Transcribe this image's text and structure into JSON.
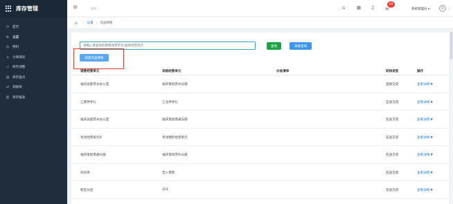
{
  "app": {
    "title": "库存管理"
  },
  "sidebar": {
    "items": [
      {
        "label": "首页",
        "icon": "home-icon",
        "glyph": "⊙",
        "active": false
      },
      {
        "label": "设置",
        "icon": "settings-icon",
        "glyph": "⚙",
        "active": true
      },
      {
        "label": "物料",
        "icon": "material-icon",
        "glyph": "◎",
        "active": false
      },
      {
        "label": "仓库库房",
        "icon": "warehouse-icon",
        "glyph": "⌂",
        "active": false
      },
      {
        "label": "库存调整",
        "icon": "adjust-icon",
        "glyph": "▭",
        "active": false
      },
      {
        "label": "库存盘点",
        "icon": "inventory-check-icon",
        "glyph": "▤",
        "active": false
      },
      {
        "label": "调拨单",
        "icon": "transfer-icon",
        "glyph": "⇄",
        "active": false
      },
      {
        "label": "库存报表",
        "icon": "report-icon",
        "glyph": "▥",
        "active": false
      }
    ]
  },
  "topbar": {
    "search_hint": "搜索...",
    "badge_count": "10",
    "user_name": "系统管理员",
    "icons": [
      "home-icon",
      "grid-icon",
      "bell-icon",
      "message-icon",
      "user-avatar-icon",
      "more-icon"
    ]
  },
  "breadcrumb": {
    "current": "设置",
    "page": "货品网络"
  },
  "toolbar": {
    "search_placeholder": "请输入要查询的销售经营单元/采购经营单元",
    "query_label": "查询",
    "advanced_query_label": "高级查询",
    "create_label": "新建货品网络"
  },
  "table": {
    "headers": [
      "销售经营单元",
      "采购经营单元",
      "价格清单",
      "转移类型",
      "操作"
    ],
    "rows": [
      {
        "sales": "福庆总部苏州办公室",
        "purchase": "福庆策划苏州分部",
        "price": "",
        "type": "直接交货",
        "action": "查看详情"
      },
      {
        "sales": "江南伴手礼",
        "purchase": "江北伴手礼",
        "price": "",
        "type": "在途交货",
        "action": "查看详情"
      },
      {
        "sales": "福庆总部苏州办公室",
        "purchase": "福庆策划南通分部",
        "price": "",
        "type": "在途交货",
        "action": "查看详情"
      },
      {
        "sales": "考试经营单元B",
        "purchase": "考试物料经营单元",
        "price": "",
        "type": "在途交货",
        "action": "查看详情"
      },
      {
        "sales": "福庆策划南通分部",
        "purchase": "福庆策划苏州分部",
        "price": "",
        "type": "在途交货",
        "action": "查看详情"
      },
      {
        "sales": "丹丹丹",
        "purchase": "无人零售",
        "price": "",
        "type": "在途交货",
        "action": "查看详情"
      },
      {
        "sales": "新区分店",
        "purchase": "424",
        "price": "",
        "type": "在途交货",
        "action": "查看详情"
      }
    ]
  },
  "colors": {
    "sidebar_bg": "#1f2d3d",
    "query_button": "#1aa544",
    "advanced_button": "#3d97e8",
    "create_button": "#5aa8ef",
    "highlight_box": "#e23d2d",
    "link": "#2f7fd1"
  }
}
